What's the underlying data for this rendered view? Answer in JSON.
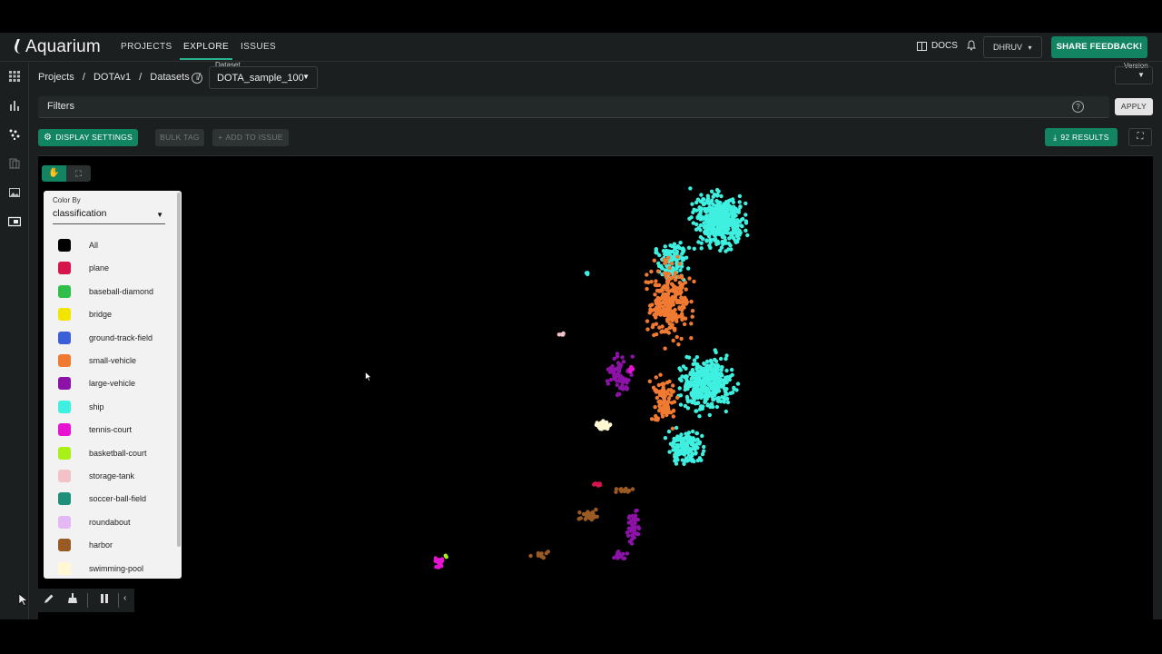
{
  "nav": {
    "logo": "Aquarium",
    "links": [
      "PROJECTS",
      "EXPLORE",
      "ISSUES"
    ],
    "docs": "DOCS",
    "user": "DHRUV",
    "feedback": "SHARE FEEDBACK!"
  },
  "breadcrumb": {
    "items": [
      "Projects",
      "/",
      "DOTAv1",
      "/",
      "Datasets",
      "/"
    ],
    "dataset_label": "Dataset",
    "dataset_value": "DOTA_sample_100",
    "version_label": "Version"
  },
  "filters": {
    "label": "Filters",
    "apply": "APPLY"
  },
  "actions": {
    "display_settings": "DISPLAY SETTINGS",
    "bulk_tag": "BULK TAG",
    "add_to_issue": "ADD TO ISSUE",
    "results": "92 RESULTS"
  },
  "legend": {
    "color_by_label": "Color By",
    "color_by_value": "classification",
    "items": [
      {
        "label": "All",
        "color": "#000000"
      },
      {
        "label": "plane",
        "color": "#d7144c"
      },
      {
        "label": "baseball-diamond",
        "color": "#2fbf4a"
      },
      {
        "label": "bridge",
        "color": "#f2e600"
      },
      {
        "label": "ground-track-field",
        "color": "#3b5fd6"
      },
      {
        "label": "small-vehicle",
        "color": "#f07a32"
      },
      {
        "label": "large-vehicle",
        "color": "#8d12a8"
      },
      {
        "label": "ship",
        "color": "#3ff0e0"
      },
      {
        "label": "tennis-court",
        "color": "#e614d2"
      },
      {
        "label": "basketball-court",
        "color": "#a8f018"
      },
      {
        "label": "storage-tank",
        "color": "#f2c2c8"
      },
      {
        "label": "soccer-ball-field",
        "color": "#1f8f7a"
      },
      {
        "label": "roundabout",
        "color": "#e4b8f2"
      },
      {
        "label": "harbor",
        "color": "#9a5a24"
      },
      {
        "label": "swimming-pool",
        "color": "#fff8d2"
      }
    ]
  },
  "icons": {
    "rail": [
      "grid-icon",
      "bar-chart-icon",
      "embedding-icon",
      "document-icon",
      "image-icon",
      "crop-icon"
    ],
    "toolbar": [
      "cursor-icon",
      "pencil-icon",
      "broom-icon",
      "pause-icon",
      "chevron-left-icon"
    ]
  }
}
